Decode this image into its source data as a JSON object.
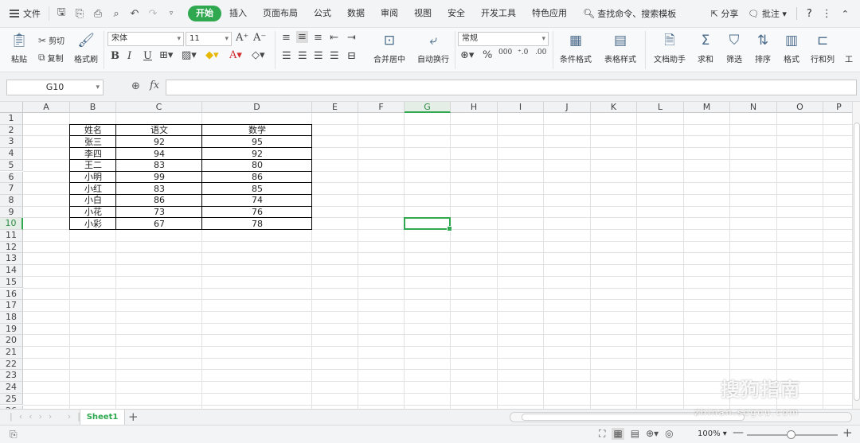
{
  "menu": {
    "file_label": "文件",
    "tabs": [
      "开始",
      "插入",
      "页面布局",
      "公式",
      "数据",
      "审阅",
      "视图",
      "安全",
      "开发工具",
      "特色应用"
    ],
    "search_label": "查找命令、搜索模板",
    "share_label": "分享",
    "comment_label": "批注"
  },
  "ribbon": {
    "paste": "粘贴",
    "cut": "剪切",
    "copy": "复制",
    "format_painter": "格式刷",
    "font_name": "宋体",
    "font_size": "11",
    "merge_center": "合并居中",
    "wrap_text": "自动换行",
    "number_format": "常规",
    "conditional_format": "条件格式",
    "table_style": "表格样式",
    "doc_assistant": "文档助手",
    "sum": "求和",
    "filter": "筛选",
    "sort": "排序",
    "format": "格式",
    "row_col": "行和列",
    "worksheet_partial": "工"
  },
  "formula_bar": {
    "name_box": "G10",
    "fx": "fx",
    "formula": ""
  },
  "grid": {
    "columns": [
      "A",
      "B",
      "C",
      "D",
      "E",
      "F",
      "G",
      "H",
      "I",
      "J",
      "K",
      "L",
      "M",
      "N",
      "O",
      "P"
    ],
    "rows": [
      "1",
      "2",
      "3",
      "4",
      "5",
      "6",
      "7",
      "8",
      "9",
      "10",
      "11",
      "12",
      "13",
      "14",
      "15",
      "16",
      "17",
      "18",
      "19",
      "20",
      "21",
      "22",
      "23",
      "24",
      "25",
      "26"
    ],
    "selected_col": "G",
    "selected_row": "10",
    "table": {
      "headers": [
        "姓名",
        "语文",
        "数学"
      ],
      "rows": [
        [
          "张三",
          "92",
          "95"
        ],
        [
          "李四",
          "94",
          "92"
        ],
        [
          "王二",
          "83",
          "80"
        ],
        [
          "小明",
          "99",
          "86"
        ],
        [
          "小红",
          "83",
          "85"
        ],
        [
          "小白",
          "86",
          "74"
        ],
        [
          "小花",
          "73",
          "76"
        ],
        [
          "小彩",
          "67",
          "78"
        ]
      ]
    }
  },
  "sheets": {
    "active": "Sheet1"
  },
  "status": {
    "zoom": "100%"
  },
  "watermark": {
    "text": "搜狗指南",
    "url": "zhinan.sogou.com"
  },
  "colors": {
    "accent": "#2fa84f"
  }
}
